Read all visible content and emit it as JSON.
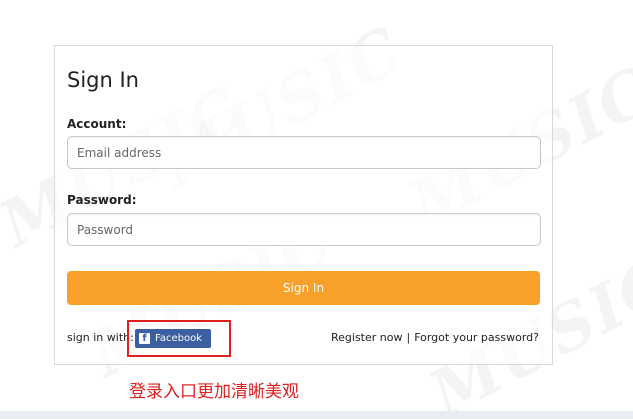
{
  "watermark": {
    "text": "MUSIC"
  },
  "form": {
    "title": "Sign In",
    "account_label": "Account:",
    "email_placeholder": "Email address",
    "password_label": "Password:",
    "password_placeholder": "Password",
    "submit_label": "Sign In",
    "sign_in_with": "sign in with:",
    "facebook_label": "Facebook",
    "facebook_icon_glyph": "f",
    "register_link": "Register now",
    "separator": "|",
    "forgot_link": "Forgot your password?"
  },
  "annotation": {
    "text": "登录入口更加清晰美观"
  },
  "colors": {
    "accent": "#f7a12a",
    "facebook": "#3b5fa0",
    "annotation": "#e02020"
  }
}
